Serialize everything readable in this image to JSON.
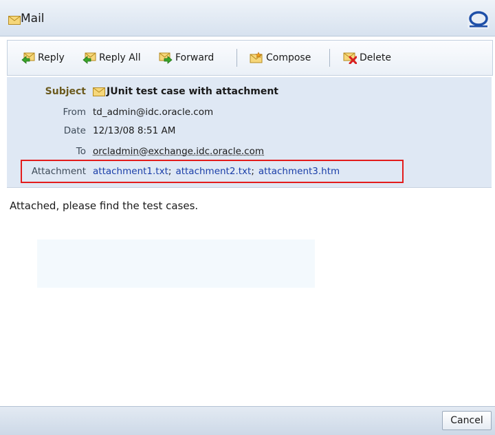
{
  "window": {
    "title": "Mail",
    "title_icon": "envelope-icon",
    "brand_icon": "oracle-o-icon"
  },
  "toolbar": {
    "reply": {
      "label": "Reply",
      "icon": "reply-icon"
    },
    "reply_all": {
      "label": "Reply All",
      "icon": "reply-all-icon"
    },
    "forward": {
      "label": "Forward",
      "icon": "forward-icon"
    },
    "compose": {
      "label": "Compose",
      "icon": "compose-icon"
    },
    "delete": {
      "label": "Delete",
      "icon": "delete-icon"
    }
  },
  "message": {
    "subject_label": "Subject",
    "subject": "JUnit test case with attachment",
    "from_label": "From",
    "from": "td_admin@idc.oracle.com",
    "date_label": "Date",
    "date": "12/13/08 8:51 AM",
    "to_label": "To",
    "to": "orcladmin@exchange.idc.oracle.com",
    "attachment_label": "Attachment",
    "attachments": [
      "attachment1.txt",
      "attachment2.txt",
      "attachment3.htm"
    ],
    "attachment_separator": ";",
    "body": "Attached, please find the test cases."
  },
  "footer": {
    "cancel_label": "Cancel"
  },
  "colors": {
    "link": "#1a3ea8",
    "highlight_frame": "#e31b1b",
    "header_bg": "#dfe8f4",
    "subject_label": "#6b5a1e"
  }
}
